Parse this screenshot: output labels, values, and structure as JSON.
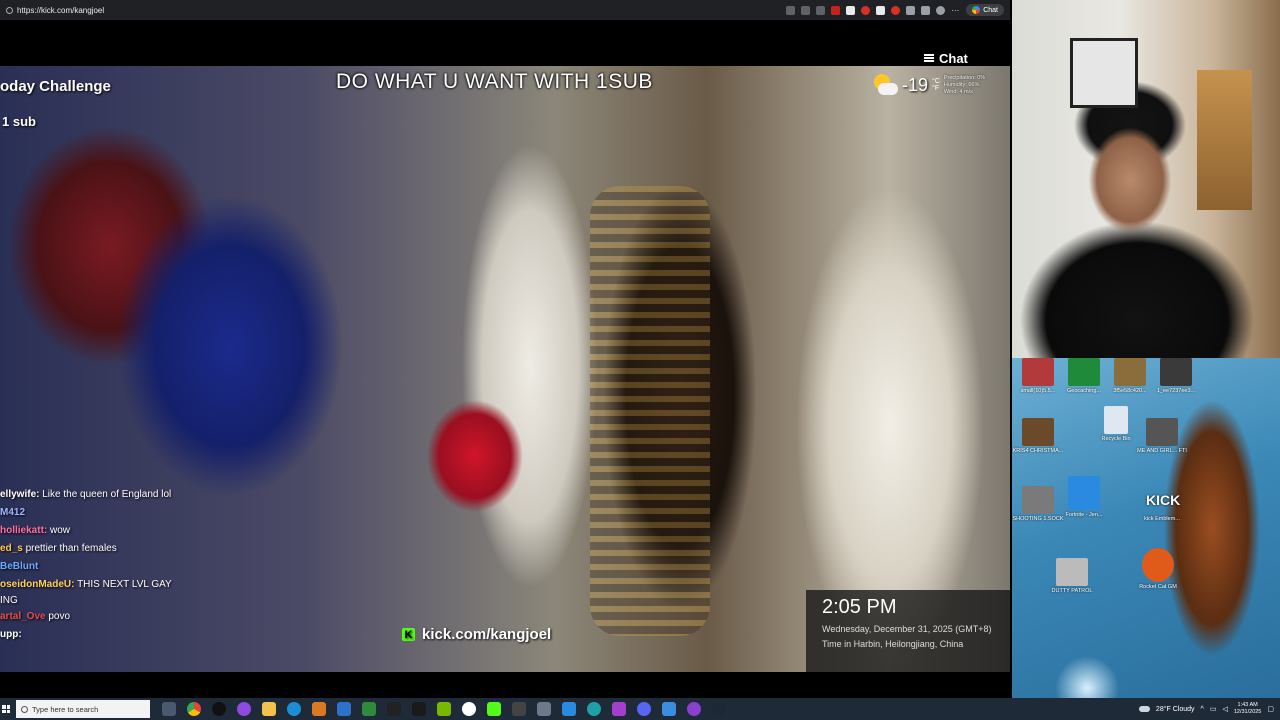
{
  "browser": {
    "url": "https://kick.com/kangjoel",
    "chat_button_label": "Chat"
  },
  "stream": {
    "chat_toggle_label": "Chat",
    "banner_text": "DO WHAT U WANT WITH 1SUB",
    "challenge_text": "oday Challenge",
    "sub_text": "1 sub",
    "weather": {
      "temperature": "-19",
      "unit": "°C\n°F",
      "details": [
        "Precipitation: 0%",
        "Humidity: 66%",
        "Wind: 4 m/s"
      ]
    },
    "clock": {
      "time": "2:05 PM",
      "date": "Wednesday, December 31, 2025 (GMT+8)",
      "location": "Time in Harbin, Heilongjiang, China"
    },
    "kick_url": "kick.com/kangjoel",
    "chat_messages": [
      {
        "user": "ellywife:",
        "text": "Like the queen of England lol",
        "color": "#ffffff"
      },
      {
        "user": "M412",
        "text": "",
        "color": "#9fb3ff"
      },
      {
        "user": "holliekatt:",
        "text": "wow",
        "color": "#ff6ea8"
      },
      {
        "user": "ed_s",
        "text": "prettier than females",
        "color": "#ffcc44"
      },
      {
        "user": "BeBlunt",
        "text": "",
        "color": "#6aa9ff"
      },
      {
        "user": "oseidonMadeU:",
        "text": "THIS NEXT LVL GAY",
        "color": "#ffd25a"
      },
      {
        "user": "",
        "text": "ING",
        "color": "#ffffff"
      },
      {
        "user": "artal_Ove",
        "text": "povo",
        "color": "#e84b4b"
      },
      {
        "user": "upp:",
        "text": "",
        "color": "#ffffff"
      }
    ]
  },
  "desktop": {
    "icons": [
      {
        "label": "small(10)5.5...",
        "color": "#b33a3a"
      },
      {
        "label": "Geocaching...",
        "color": "#1f8a3a"
      },
      {
        "label": "3f5e58c420...",
        "color": "#8a6d3b"
      },
      {
        "label": "1_ee7237ee3...",
        "color": "#3a3a3a"
      },
      {
        "label": "KRIS4 CHRISTMA...",
        "color": "#6b4a2a"
      },
      {
        "label": "Recycle Bin",
        "color": "#dfe8f0"
      },
      {
        "label": "ME AND GIRL... FTI",
        "color": "#555555"
      },
      {
        "label": "SHOOTING 1.SOCK",
        "color": "#7a7a7a"
      },
      {
        "label": "Fortnite - Jen...",
        "color": "#2a8ae0"
      },
      {
        "label": "kick Emblem...",
        "color": "#222222"
      },
      {
        "label": "DUTTY PATROL",
        "color": "#bbbbbb"
      },
      {
        "label": "Rocket Cat GM",
        "color": "#e05a1a"
      }
    ]
  },
  "taskbar": {
    "search_placeholder": "Type here to search",
    "weather": "28°F Cloudy",
    "time": "1:43 AM",
    "date": "12/31/2025"
  }
}
